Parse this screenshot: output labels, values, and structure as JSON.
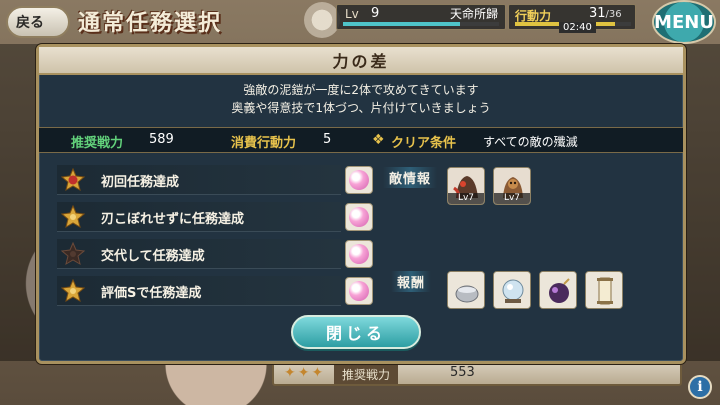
{
  "topbar": {
    "back_label": "戻る",
    "screen_title": "通常任務選択",
    "level_label": "Lv",
    "level_value": "9",
    "level_progress": 0.75,
    "rank_name": "天命所歸",
    "stamina_label": "行動力",
    "stamina_current": "31",
    "stamina_max": "/36",
    "stamina_progress": 0.86,
    "stamina_timer": "02:40",
    "menu_label": "MENU"
  },
  "modal": {
    "title": "力の差",
    "description_line1": "強敵の泥鎧が一度に2体で攻めてきています",
    "description_line2": "奥義や得意技で1体づつ、片付けていきましょう",
    "recommended_power_label": "推奨戦力",
    "recommended_power_value": "589",
    "stamina_cost_label": "消費行動力",
    "stamina_cost_value": "5",
    "clear_condition_label": "クリア条件",
    "clear_condition_value": "すべての敵の殲滅",
    "objectives": [
      {
        "label": "初回任務達成",
        "icon": "red-gold-medal-icon"
      },
      {
        "label": "刃こぼれせずに任務達成",
        "icon": "gold-star-medal-icon"
      },
      {
        "label": "交代して任務達成",
        "icon": "dark-star-medal-icon"
      },
      {
        "label": "評価Sで任務達成",
        "icon": "gold-star-medal-icon"
      }
    ],
    "enemy_label": "敵情報",
    "enemies": [
      {
        "level": "Lv7",
        "icon": "red-mud-armor-enemy-icon"
      },
      {
        "level": "Lv7",
        "icon": "orange-mud-armor-enemy-icon"
      }
    ],
    "reward_label": "報酬",
    "rewards": [
      {
        "icon": "silver-bowl-item-icon"
      },
      {
        "icon": "crystal-orb-item-icon"
      },
      {
        "icon": "purple-bomb-item-icon"
      },
      {
        "icon": "scroll-item-icon"
      }
    ],
    "close_label": "閉じる"
  },
  "underlying": {
    "recommended_power_label": "推奨戦力",
    "recommended_power_value": "553"
  },
  "colors": {
    "modal_bg": "#223341",
    "modal_border": "#a8915f",
    "recommended_green": "#62d17b",
    "gold_label": "#e7c24c",
    "teal_button": "#2d9ea3"
  }
}
